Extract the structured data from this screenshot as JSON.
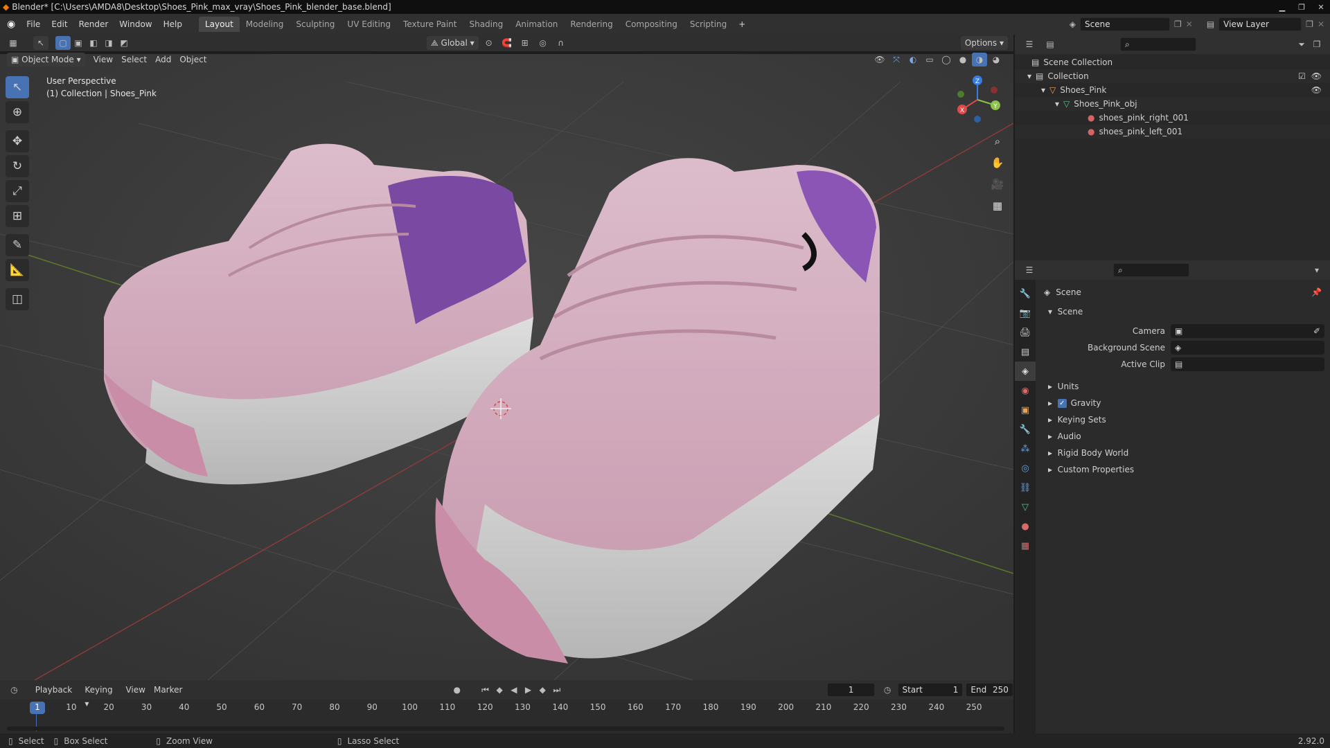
{
  "title": "Blender* [C:\\Users\\AMDA8\\Desktop\\Shoes_Pink_max_vray\\Shoes_Pink_blender_base.blend]",
  "menus": [
    "File",
    "Edit",
    "Render",
    "Window",
    "Help"
  ],
  "workspaces": [
    "Layout",
    "Modeling",
    "Sculpting",
    "UV Editing",
    "Texture Paint",
    "Shading",
    "Animation",
    "Rendering",
    "Compositing",
    "Scripting"
  ],
  "active_workspace": "Layout",
  "scene_field": "Scene",
  "view_layer_field": "View Layer",
  "header": {
    "transform_orientation": "Global",
    "options": "Options"
  },
  "viewport_menu": {
    "mode": "Object Mode",
    "items": [
      "View",
      "Select",
      "Add",
      "Object"
    ]
  },
  "viewport_info": {
    "line1": "User Perspective",
    "line2": "(1) Collection | Shoes_Pink"
  },
  "gizmo": {
    "x": "X",
    "y": "Y",
    "z": "Z"
  },
  "outliner": {
    "rows": [
      {
        "label": "Scene Collection",
        "indent": 0
      },
      {
        "label": "Collection",
        "indent": 1
      },
      {
        "label": "Shoes_Pink",
        "indent": 2
      },
      {
        "label": "Shoes_Pink_obj",
        "indent": 3
      },
      {
        "label": "shoes_pink_right_001",
        "indent": 4
      },
      {
        "label": "shoes_pink_left_001",
        "indent": 4
      }
    ]
  },
  "properties": {
    "context": "Scene",
    "panel": "Scene",
    "fields": [
      {
        "label": "Camera",
        "value": ""
      },
      {
        "label": "Background Scene",
        "value": ""
      },
      {
        "label": "Active Clip",
        "value": ""
      }
    ],
    "subpanels": [
      "Units",
      "Gravity",
      "Keying Sets",
      "Audio",
      "Rigid Body World",
      "Custom Properties"
    ],
    "gravity_checked": true
  },
  "timeline": {
    "menus": [
      "Playback",
      "Keying",
      "View",
      "Marker"
    ],
    "current_frame": "1",
    "start_label": "Start",
    "start": "1",
    "end_label": "End",
    "end": "250",
    "ticks": [
      "1",
      "10",
      "20",
      "30",
      "40",
      "50",
      "60",
      "70",
      "80",
      "90",
      "100",
      "110",
      "120",
      "130",
      "140",
      "150",
      "160",
      "170",
      "180",
      "190",
      "200",
      "210",
      "220",
      "230",
      "240",
      "250"
    ]
  },
  "status": {
    "select": "Select",
    "box_select": "Box Select",
    "zoom_view": "Zoom View",
    "lasso_select": "Lasso Select",
    "version": "2.92.0"
  }
}
